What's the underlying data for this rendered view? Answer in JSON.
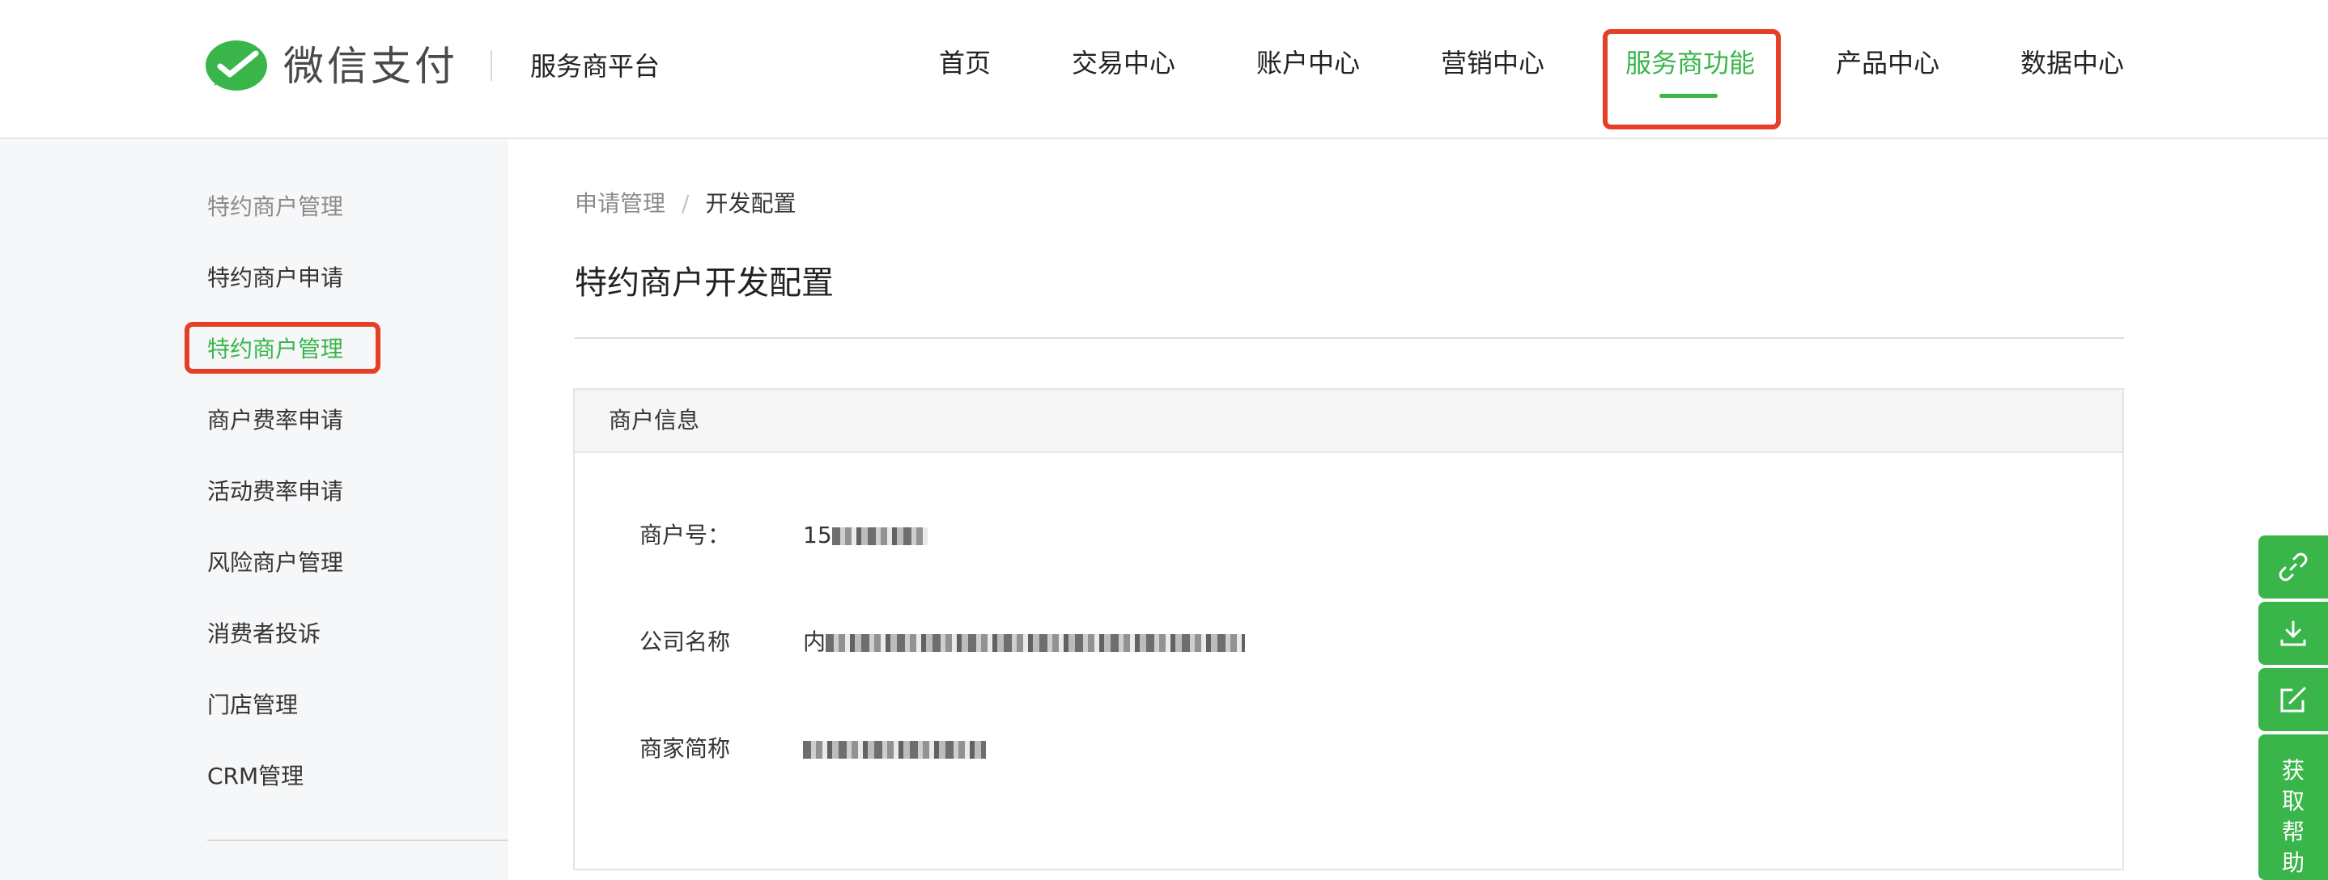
{
  "header": {
    "logo_text": "微信支付",
    "platform_name": "服务商平台",
    "nav": [
      {
        "label": "首页"
      },
      {
        "label": "交易中心"
      },
      {
        "label": "账户中心"
      },
      {
        "label": "营销中心"
      },
      {
        "label": "服务商功能",
        "active": true
      },
      {
        "label": "产品中心"
      },
      {
        "label": "数据中心"
      }
    ]
  },
  "sidebar": {
    "items": [
      {
        "label": "特约商户管理",
        "type": "group"
      },
      {
        "label": "特约商户申请"
      },
      {
        "label": "特约商户管理",
        "active": true
      },
      {
        "label": "商户费率申请"
      },
      {
        "label": "活动费率申请"
      },
      {
        "label": "风险商户管理"
      },
      {
        "label": "消费者投诉"
      },
      {
        "label": "门店管理"
      },
      {
        "label": "CRM管理"
      }
    ]
  },
  "breadcrumb": {
    "parent": "申请管理",
    "separator": "/",
    "current": "开发配置"
  },
  "page_title": "特约商户开发配置",
  "merchant_panel": {
    "title": "商户信息",
    "fields": [
      {
        "label": "商户号：",
        "value_visible": "15"
      },
      {
        "label": "公司名称",
        "value_visible": "内"
      },
      {
        "label": "商家简称",
        "value_visible": ""
      }
    ]
  },
  "float_tools": {
    "icons": [
      "link-icon",
      "download-icon",
      "edit-icon"
    ],
    "help_label": "获取帮助"
  },
  "colors": {
    "accent_green": "#39b54a",
    "highlight_red": "#e53f28",
    "sidebar_bg": "#f6f7f9"
  }
}
